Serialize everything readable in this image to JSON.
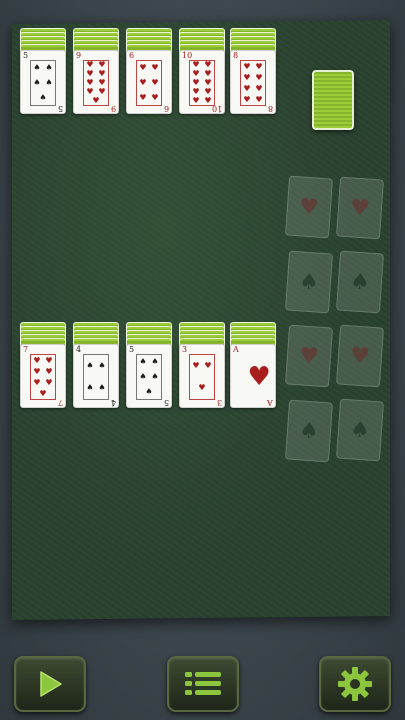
{
  "top_row": [
    {
      "rank": "5",
      "suit": "♠",
      "color": "black",
      "pips": 5
    },
    {
      "rank": "9",
      "suit": "♥",
      "color": "red",
      "pips": 9
    },
    {
      "rank": "6",
      "suit": "♥",
      "color": "red",
      "pips": 6
    },
    {
      "rank": "10",
      "suit": "♥",
      "color": "red",
      "pips": 10
    },
    {
      "rank": "8",
      "suit": "♥",
      "color": "red",
      "pips": 8
    }
  ],
  "bottom_row": [
    {
      "rank": "7",
      "suit": "♥",
      "color": "red",
      "pips": 7
    },
    {
      "rank": "4",
      "suit": "♠",
      "color": "black",
      "pips": 4
    },
    {
      "rank": "5",
      "suit": "♠",
      "color": "black",
      "pips": 5
    },
    {
      "rank": "3",
      "suit": "♥",
      "color": "red",
      "pips": 3
    },
    {
      "rank": "A",
      "suit": "♥",
      "color": "red",
      "pips": 1
    }
  ],
  "foundations": [
    {
      "suit": "♥",
      "color": "red"
    },
    {
      "suit": "♥",
      "color": "red"
    },
    {
      "suit": "♠",
      "color": "black"
    },
    {
      "suit": "♠",
      "color": "black"
    },
    {
      "suit": "♥",
      "color": "red"
    },
    {
      "suit": "♥",
      "color": "red"
    },
    {
      "suit": "♠",
      "color": "black"
    },
    {
      "suit": "♠",
      "color": "black"
    }
  ],
  "colors": {
    "felt": "#2a4230",
    "card_back": "#8fbf2f",
    "red_suit": "#a81e1e",
    "black_suit": "#1b1b1b",
    "button_icon": "#8cc63f"
  },
  "toolbar": {
    "play_icon": "play-icon",
    "menu_icon": "menu-icon",
    "settings_icon": "gear-icon"
  }
}
